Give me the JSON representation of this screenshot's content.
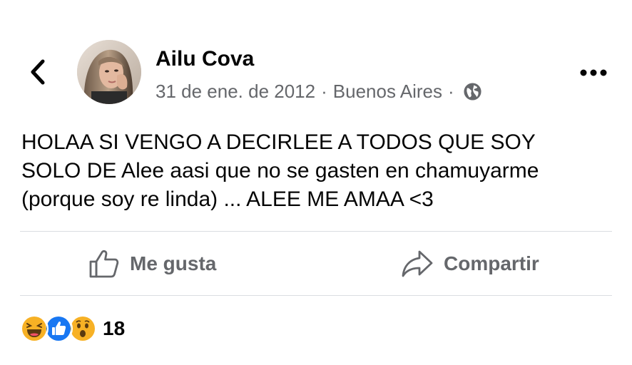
{
  "post": {
    "author_name": "Ailu Cova",
    "date": "31 de ene. de 2012",
    "separator": "·",
    "location": "Buenos Aires",
    "privacy_icon": "globe-icon",
    "text_lines": [
      "HOLAA SI VENGO A DECIRLEE A TODOS QUE SOY",
      "SOLO DE Alee aasi que no se gasten en chamuyarme",
      "(porque soy re linda) ... ALEE ME AMAA <3"
    ]
  },
  "header": {
    "back_icon": "chevron-left-icon",
    "more_icon": "more-options-icon"
  },
  "actions": {
    "like_label": "Me gusta",
    "share_label": "Compartir"
  },
  "reactions": {
    "types": [
      "haha",
      "like",
      "wow"
    ],
    "count": "18"
  },
  "colors": {
    "text_primary": "#050505",
    "text_secondary": "#65676b",
    "like_blue": "#1877f2",
    "emoji_yellow": "#f7b125",
    "divider": "#dadde1"
  }
}
